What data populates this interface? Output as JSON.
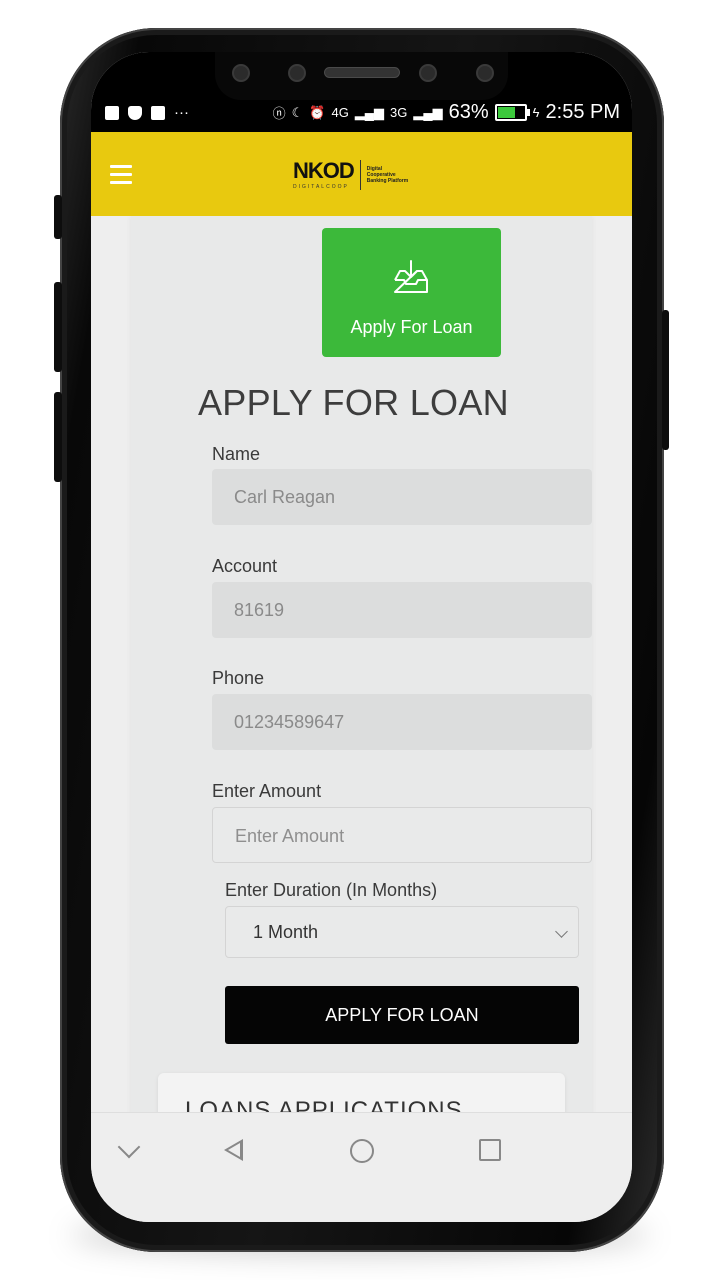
{
  "status_bar": {
    "network": "4G",
    "network2": "3G",
    "battery": "63%",
    "battery_level": 0.63,
    "time": "2:55 PM"
  },
  "app_bar": {
    "logo_text": "NKOD",
    "logo_sub": "DIGITALCOOP",
    "logo_tagline": "Digital Cooperative Banking Platform",
    "brand_color": "#e8c90f"
  },
  "tile": {
    "label": "Apply For Loan",
    "color": "#3cb93a"
  },
  "form": {
    "title": "APPLY FOR LOAN",
    "name_label": "Name",
    "name_value": "Carl Reagan",
    "account_label": "Account",
    "account_value": "81619",
    "phone_label": "Phone",
    "phone_value": "01234589647",
    "amount_label": "Enter Amount",
    "amount_placeholder": "Enter Amount",
    "duration_label": "Enter Duration (In Months)",
    "duration_selected": "1 Month",
    "submit_label": "APPLY FOR LOAN"
  },
  "loans": {
    "title": "LOANS APPLICATIONS"
  }
}
